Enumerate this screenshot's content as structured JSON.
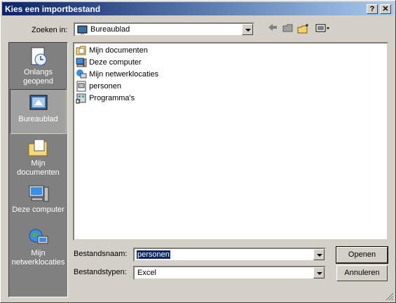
{
  "window": {
    "title": "Kies een importbestand",
    "help_label": "?",
    "close_label": "✕"
  },
  "lookin": {
    "label": "Zoeken in:",
    "value": "Bureaublad"
  },
  "toolbar": {
    "back_icon": "back-arrow-icon",
    "up_icon": "up-folder-icon",
    "new_icon": "new-folder-icon",
    "view_icon": "view-menu-icon"
  },
  "places": [
    {
      "label": "Onlangs geopend",
      "icon": "recent-icon"
    },
    {
      "label": "Bureaublad",
      "icon": "desktop-icon"
    },
    {
      "label": "Mijn documenten",
      "icon": "my-documents-icon"
    },
    {
      "label": "Deze computer",
      "icon": "my-computer-icon"
    },
    {
      "label": "Mijn netwerklocaties",
      "icon": "network-places-icon"
    }
  ],
  "files": [
    {
      "name": "Mijn documenten",
      "icon": "folder-documents-icon"
    },
    {
      "name": "Deze computer",
      "icon": "computer-icon"
    },
    {
      "name": "Mijn netwerklocaties",
      "icon": "network-icon"
    },
    {
      "name": "personen",
      "icon": "data-file-icon"
    },
    {
      "name": "Programma's",
      "icon": "program-shortcut-icon"
    }
  ],
  "filename": {
    "label": "Bestandsnaam:",
    "value": "personen"
  },
  "filetype": {
    "label": "Bestandstypen:",
    "value": "Excel"
  },
  "buttons": {
    "open": "Openen",
    "cancel": "Annuleren"
  }
}
